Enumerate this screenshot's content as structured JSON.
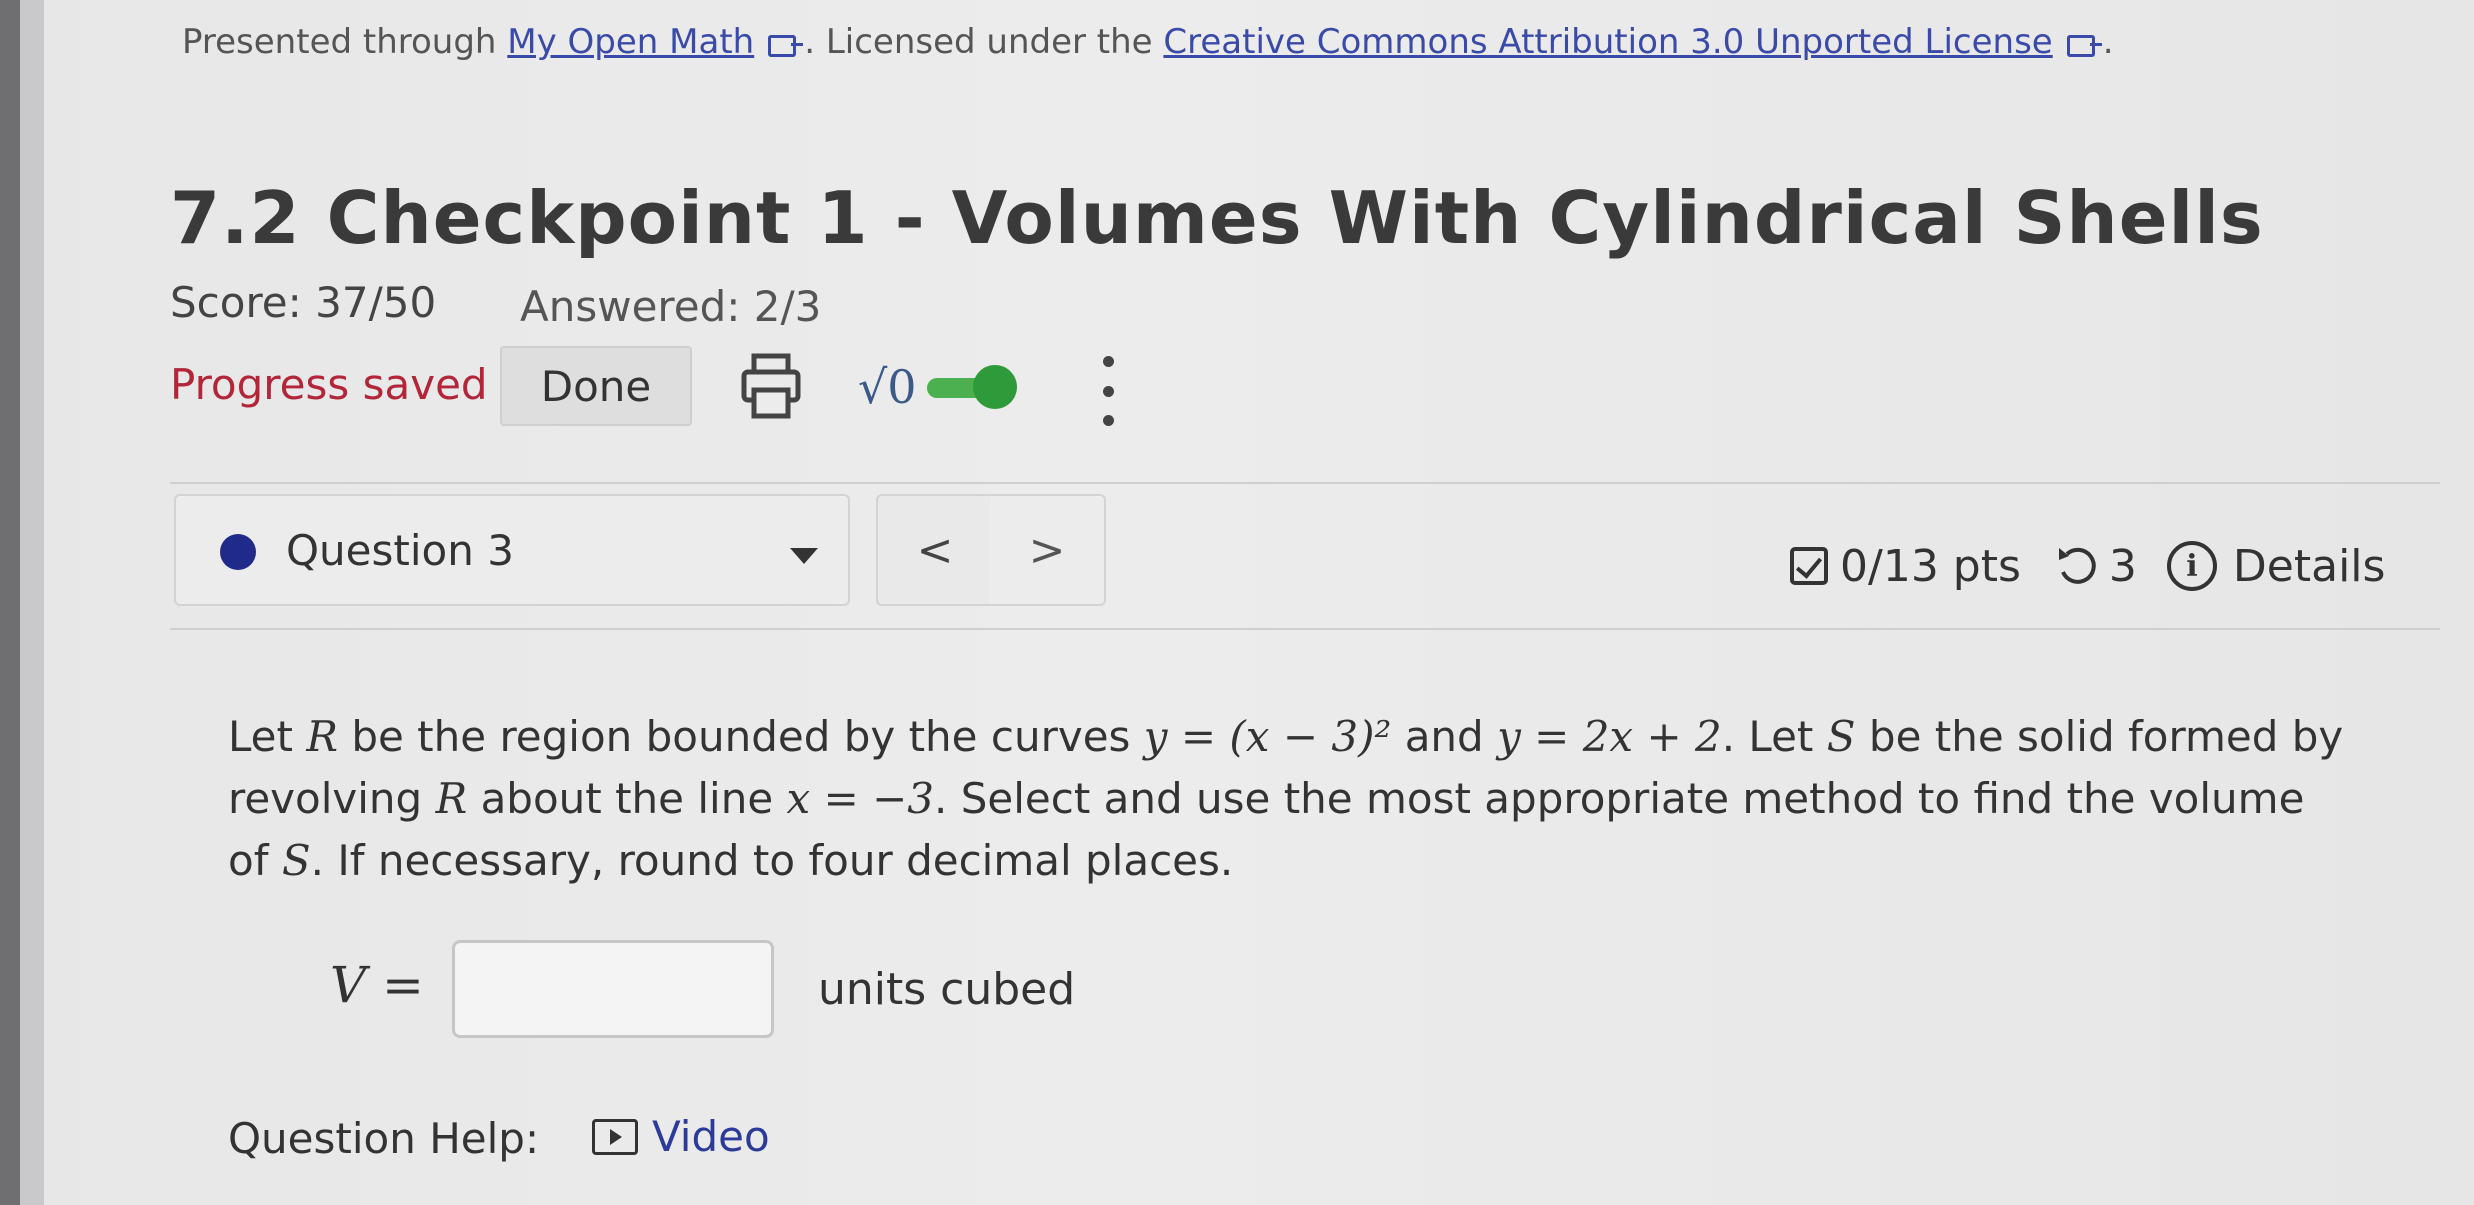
{
  "license": {
    "prefix": "Presented through",
    "link1": "My Open Math",
    "middle": ". Licensed under the",
    "link2": "Creative Commons Attribution 3.0 Unported License",
    "suffix": "."
  },
  "assignment": {
    "title": "7.2 Checkpoint 1 - Volumes With Cylindrical Shells",
    "score": "Score: 37/50",
    "answered": "Answered: 2/3",
    "progress": "Progress saved",
    "done_label": "Done",
    "sqrt_label": "√0"
  },
  "question_nav": {
    "selected": "Question 3",
    "prev": "<",
    "next": ">",
    "points": "0/13 pts",
    "retries": "3",
    "details": "Details"
  },
  "problem": {
    "t1": "Let",
    "R": "R",
    "t2": "be the region bounded by the curves",
    "curve1": "y = (x − 3)²",
    "t3": "and",
    "curve2": "y = 2x + 2",
    "t4": ". Let",
    "S": "S",
    "t5": "be the solid formed by revolving",
    "R2": "R",
    "t6": "about the line",
    "axis": "x = −3",
    "t7": ". Select and use the most appropriate method to find the volume of",
    "S2": "S",
    "t8": ". If necessary, round to four decimal places."
  },
  "answer": {
    "label": "V =",
    "value": "",
    "units": "units cubed"
  },
  "help": {
    "label": "Question Help:",
    "video": "Video"
  },
  "colors": {
    "link": "#3a4aa8",
    "progress": "#b3263a",
    "toggle_on": "#4caf50",
    "question_dot": "#1f2a8a"
  }
}
